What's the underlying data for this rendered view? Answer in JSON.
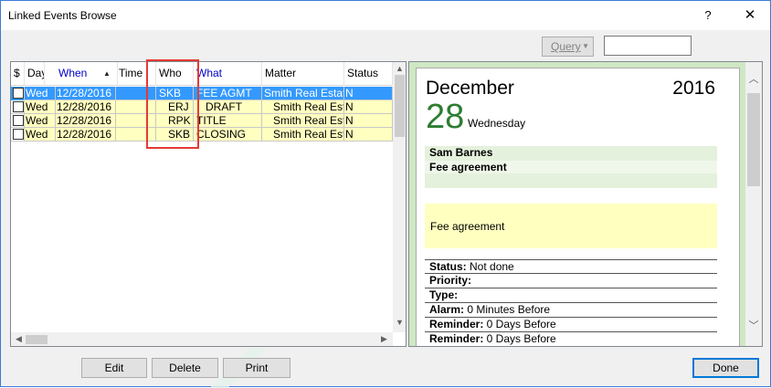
{
  "window": {
    "title": "Linked Events Browse",
    "help_glyph": "?",
    "close_glyph": "✕"
  },
  "toolbar": {
    "query_label": "Query",
    "query_arrow": "▼",
    "query_value": ""
  },
  "grid": {
    "columns": [
      "$",
      "Day",
      "When",
      "Time",
      "Who",
      "What",
      "Matter",
      "Status"
    ],
    "sort_glyph": "▲",
    "rows": [
      {
        "day": "Wed",
        "when": "12/28/2016",
        "time": "",
        "who": "SKB",
        "what": "FEE AGMT",
        "matter": "Smith Real Estate",
        "status": "N"
      },
      {
        "day": "Wed",
        "when": "12/28/2016",
        "time": "",
        "who": "ERJ",
        "what": "DRAFT",
        "matter": "Smith Real Estate",
        "status": "N"
      },
      {
        "day": "Wed",
        "when": "12/28/2016",
        "time": "",
        "who": "RPK",
        "what": "TITLE",
        "matter": "Smith Real Estate",
        "status": "N"
      },
      {
        "day": "Wed",
        "when": "12/28/2016",
        "time": "",
        "who": "SKB",
        "what": "CLOSING",
        "matter": "Smith Real Estate",
        "status": "N"
      }
    ],
    "scroll_up": "▲",
    "scroll_down": "▼",
    "scroll_left": "◀",
    "scroll_right": "▶"
  },
  "detail": {
    "month": "December",
    "year": "2016",
    "day": "28",
    "weekday": "Wednesday",
    "who": "Sam Barnes",
    "what": "Fee agreement",
    "note": "Fee agreement",
    "fields": [
      {
        "label": "Status:",
        "value": " Not done"
      },
      {
        "label": "Priority:",
        "value": ""
      },
      {
        "label": "Type:",
        "value": ""
      },
      {
        "label": "Alarm:",
        "value": " 0 Minutes Before"
      },
      {
        "label": "Reminder:",
        "value": " 0 Days Before"
      },
      {
        "label": "Reminder:",
        "value": " 0 Days Before"
      }
    ],
    "scroll_up": "︿",
    "scroll_down": "﹀"
  },
  "buttons": {
    "edit": "Edit",
    "delete": "Delete",
    "print": "Print",
    "done": "Done"
  },
  "colors": {
    "selected_row": "#3399ff",
    "row_highlight": "#ffffc0",
    "header_link": "#0000cc",
    "day_number": "#2e7d32",
    "panel_green": "#cfe8c4",
    "annotation": "#e53935"
  }
}
